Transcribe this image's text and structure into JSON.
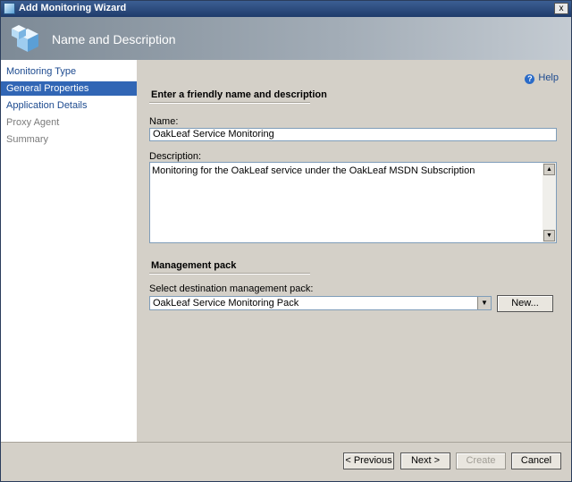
{
  "window": {
    "title": "Add Monitoring Wizard",
    "close_glyph": "x",
    "icon": "wizard-icon"
  },
  "header": {
    "title": "Name and Description",
    "icon": "cubes-icon"
  },
  "nav": {
    "items": [
      {
        "label": "Monitoring Type",
        "state": "link"
      },
      {
        "label": "General Properties",
        "state": "selected"
      },
      {
        "label": "Application Details",
        "state": "link"
      },
      {
        "label": "Proxy Agent",
        "state": "disabled"
      },
      {
        "label": "Summary",
        "state": "disabled"
      }
    ]
  },
  "help": {
    "label": "Help",
    "icon": "help-icon"
  },
  "section1": {
    "title": "Enter a friendly name and description"
  },
  "name": {
    "label": "Name:",
    "value": "OakLeaf Service Monitoring"
  },
  "description": {
    "label": "Description:",
    "value": "Monitoring for the OakLeaf service under the OakLeaf MSDN Subscription"
  },
  "section2": {
    "title": "Management pack"
  },
  "mgmt_pack": {
    "label": "Select destination management pack:",
    "value": "OakLeaf Service Monitoring Pack",
    "new_label": "New..."
  },
  "footer": {
    "previous_label": "< Previous",
    "next_label": "Next >",
    "create_label": "Create",
    "cancel_label": "Cancel"
  }
}
